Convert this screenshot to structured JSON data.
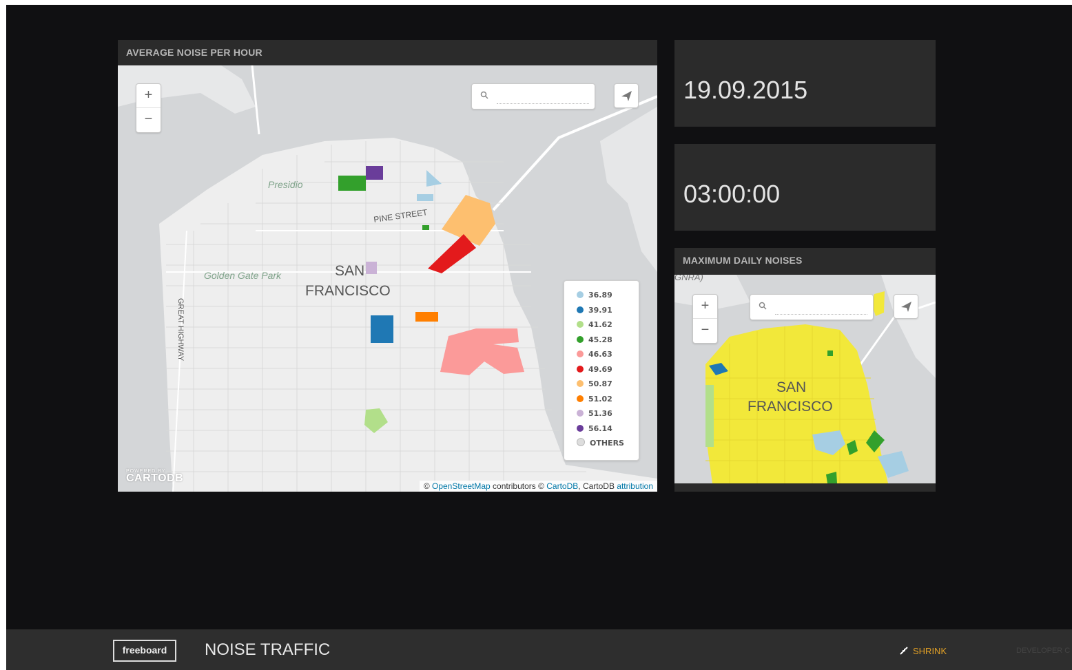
{
  "app": {
    "brand": "freeboard",
    "dashboard_title": "NOISE TRAFFIC"
  },
  "footer": {
    "shrink_label": "SHRINK",
    "developer_label": "DEVELOPER C"
  },
  "panes": {
    "average_noise": {
      "title": "AVERAGE NOISE PER HOUR",
      "map": {
        "zoom_in": "+",
        "zoom_out": "−",
        "search_placeholder": "",
        "labels": {
          "presidio": "Presidio",
          "pine_street": "PINE STREET",
          "golden_gate_park": "Golden Gate Park",
          "san": "SAN",
          "francisco": "FRANCISCO",
          "great_highway": "GREAT HIGHWAY"
        },
        "legend": [
          {
            "label": "36.89",
            "color": "#a6cee3"
          },
          {
            "label": "39.91",
            "color": "#1f78b4"
          },
          {
            "label": "41.62",
            "color": "#b2df8a"
          },
          {
            "label": "45.28",
            "color": "#33a02c"
          },
          {
            "label": "46.63",
            "color": "#fb9a99"
          },
          {
            "label": "49.69",
            "color": "#e31a1c"
          },
          {
            "label": "50.87",
            "color": "#fdbf6f"
          },
          {
            "label": "51.02",
            "color": "#ff7f00"
          },
          {
            "label": "51.36",
            "color": "#cab2d6"
          },
          {
            "label": "56.14",
            "color": "#6a3d9a"
          },
          {
            "label": "OTHERS",
            "color": "#dddddd"
          }
        ],
        "logo_small": "POWERED BY",
        "logo": "CARTODB",
        "attribution": {
          "prefix": "© ",
          "osm": "OpenStreetMap",
          "mid": " contributors © ",
          "cartodb": "CartoDB",
          "mid2": ", CartoDB ",
          "attr": "attribution"
        }
      }
    },
    "date": {
      "value": "19.09.2015"
    },
    "time": {
      "value": "03:00:00"
    },
    "max_daily": {
      "title": "MAXIMUM DAILY NOISES",
      "map": {
        "zoom_in": "+",
        "zoom_out": "−",
        "search_placeholder": "",
        "labels": {
          "gnra": "GNRA)",
          "san": "SAN",
          "francisco": "FRANCISCO"
        }
      }
    }
  }
}
